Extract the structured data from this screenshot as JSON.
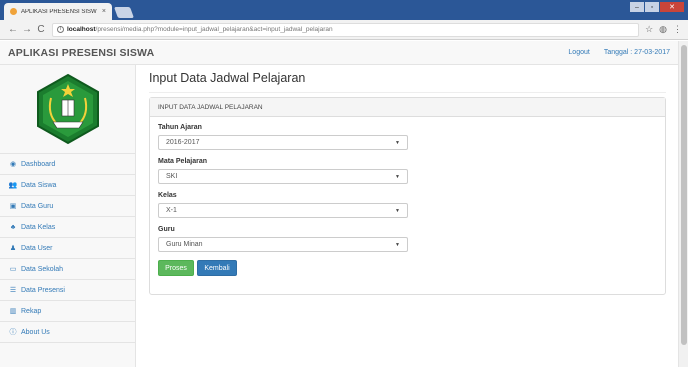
{
  "browser": {
    "tab_title": "APLIKASI PRESENSI SISW",
    "tab_close": "×",
    "url_host": "localhost",
    "url_rest": "/presensi/media.php?module=input_jadwal_pelajaran&act=input_jadwal_pelajaran",
    "window_controls": [
      "–",
      "▫",
      "✕"
    ],
    "nav": {
      "back": "←",
      "forward": "→",
      "reload": "C"
    },
    "toolbar": {
      "star": "☆",
      "extension": "◍",
      "menu": "⋮"
    }
  },
  "header": {
    "brand": "APLIKASI PRESENSI SISWA",
    "logout_label": "Logout",
    "date_label": "Tanggal : 27-03-2017"
  },
  "sidebar": {
    "items": [
      {
        "label": "Dashboard",
        "icon": "dashboard-icon",
        "glyph": "◉"
      },
      {
        "label": "Data Siswa",
        "icon": "users-icon",
        "glyph": "👥"
      },
      {
        "label": "Data Guru",
        "icon": "teacher-icon",
        "glyph": "▣"
      },
      {
        "label": "Data Kelas",
        "icon": "sitemap-icon",
        "glyph": "♣"
      },
      {
        "label": "Data User",
        "icon": "user-icon",
        "glyph": "♟"
      },
      {
        "label": "Data Sekolah",
        "icon": "monitor-icon",
        "glyph": "▭"
      },
      {
        "label": "Data Presensi",
        "icon": "list-icon",
        "glyph": "☰"
      },
      {
        "label": "Rekap",
        "icon": "bar-chart-icon",
        "glyph": "▥"
      },
      {
        "label": "About Us",
        "icon": "info-icon",
        "glyph": "ⓘ"
      }
    ]
  },
  "main": {
    "title": "Input Data Jadwal Pelajaran",
    "panel_heading": "INPUT DATA JADWAL PELAJARAN",
    "fields": [
      {
        "label": "Tahun Ajaran",
        "value": "2016-2017"
      },
      {
        "label": "Mata Pelajaran",
        "value": "SKI"
      },
      {
        "label": "Kelas",
        "value": "X-1"
      },
      {
        "label": "Guru",
        "value": "Guru Minan"
      }
    ],
    "buttons": {
      "submit": "Proses",
      "back": "Kembali"
    }
  },
  "colors": {
    "link": "#337ab7",
    "success": "#5cb85c",
    "primary": "#337ab7",
    "titlebar": "#2b5797"
  }
}
